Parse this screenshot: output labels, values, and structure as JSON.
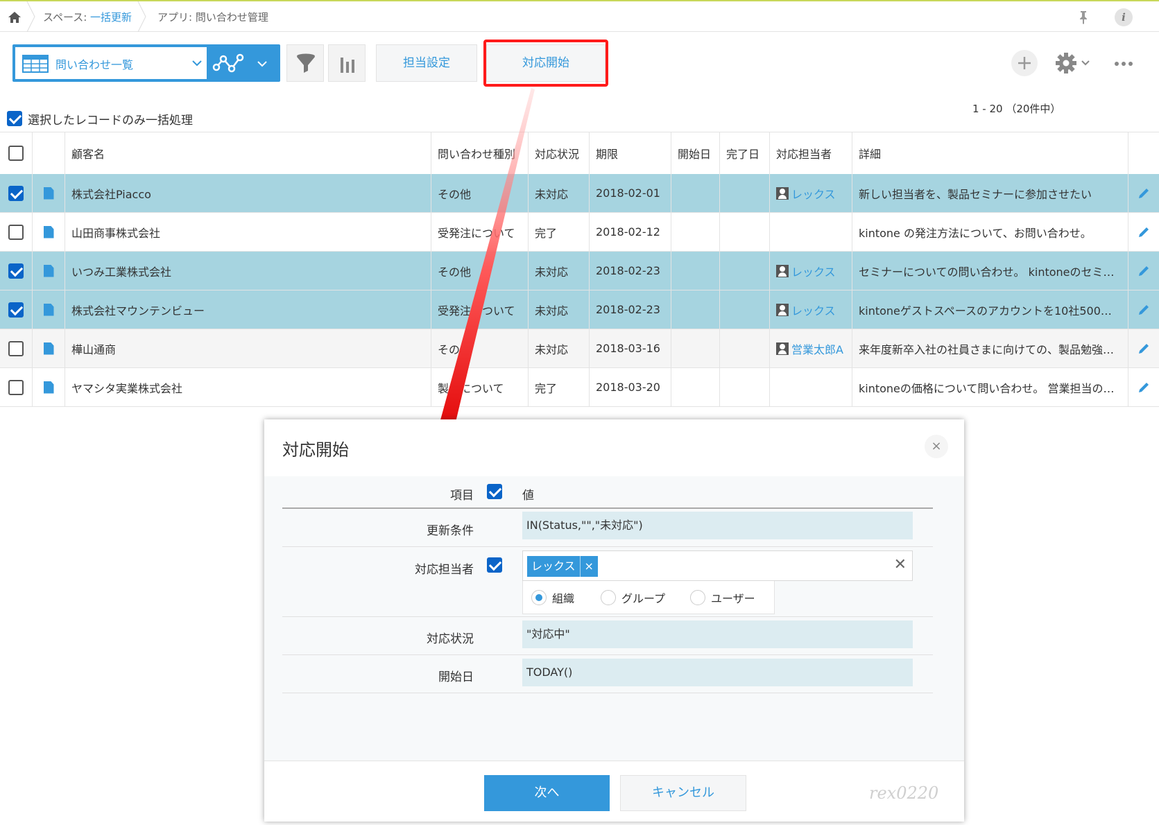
{
  "breadcrumb": {
    "space_prefix": "スペース: ",
    "space_name": "一括更新",
    "app": "アプリ: 問い合わせ管理"
  },
  "toolbar": {
    "view_name": "問い合わせ一覧",
    "button_assign": "担当設定",
    "button_start": "対応開始"
  },
  "pager": "1 - 20 （20件中）",
  "bulk_label": "選択したレコードのみ一括処理",
  "table": {
    "headers": [
      "顧客名",
      "問い合わせ種別",
      "対応状況",
      "期限",
      "開始日",
      "完了日",
      "対応担当者",
      "詳細"
    ],
    "rows": [
      {
        "checked": true,
        "customer": "株式会社Piacco",
        "type": "その他",
        "status": "未対応",
        "due": "2018-02-01",
        "start": "",
        "done": "",
        "assignee": "レックス",
        "detail": "新しい担当者を、製品セミナーに参加させたい"
      },
      {
        "checked": false,
        "customer": "山田商事株式会社",
        "type": "受発注について",
        "status": "完了",
        "due": "2018-02-12",
        "start": "",
        "done": "",
        "assignee": "",
        "detail": "kintone の発注方法について、お問い合わせ。"
      },
      {
        "checked": true,
        "customer": "いつみ工業株式会社",
        "type": "その他",
        "status": "未対応",
        "due": "2018-02-23",
        "start": "",
        "done": "",
        "assignee": "レックス",
        "detail": "セミナーについての問い合わせ。 kintoneのセミ…"
      },
      {
        "checked": true,
        "customer": "株式会社マウンテンビュー",
        "type": "受発注について",
        "status": "未対応",
        "due": "2018-02-23",
        "start": "",
        "done": "",
        "assignee": "レックス",
        "detail": "kintoneゲストスペースのアカウントを10社500…"
      },
      {
        "checked": false,
        "customer": "樺山通商",
        "type": "その他",
        "status": "未対応",
        "due": "2018-03-16",
        "start": "",
        "done": "",
        "assignee": "営業太郎A",
        "detail": "来年度新卒入社の社員さまに向けての、製品勉強…"
      },
      {
        "checked": false,
        "customer": "ヤマシタ実業株式会社",
        "type": "製品について",
        "status": "完了",
        "due": "2018-03-20",
        "start": "",
        "done": "",
        "assignee": "",
        "detail": "kintoneの価格について問い合わせ。 営業担当の…"
      }
    ]
  },
  "dialog": {
    "title": "対応開始",
    "head_item": "項目",
    "head_value": "値",
    "rows": {
      "condition_label": "更新条件",
      "condition_value": "IN(Status,\"\",\"未対応\")",
      "assignee_label": "対応担当者",
      "assignee_tag": "レックス",
      "assignee_tag_remove": "×",
      "assignee_clear": "✕",
      "radio_org": "組織",
      "radio_group": "グループ",
      "radio_user": "ユーザー",
      "status_label": "対応状況",
      "status_value": "\"対応中\"",
      "start_label": "開始日",
      "start_value": "TODAY()"
    },
    "next_button": "次へ",
    "cancel_button": "キャンセル",
    "close_glyph": "×",
    "watermark": "rex0220"
  },
  "icons": {
    "info_glyph": "i"
  },
  "colors": {
    "accent": "#3498db",
    "selected_row": "#a6d4e0",
    "highlight": "#ff1a1a"
  }
}
